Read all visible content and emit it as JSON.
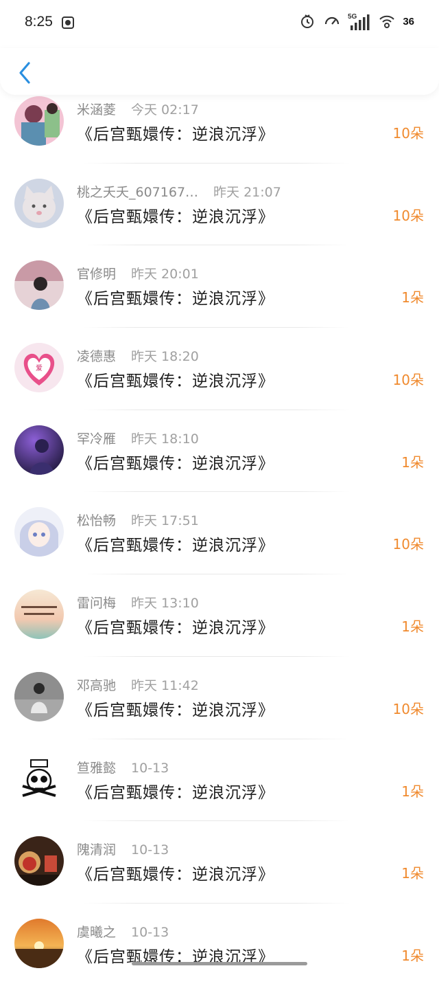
{
  "status_bar": {
    "time": "8:25",
    "network": "5G",
    "battery": "36"
  },
  "header": {
    "back_icon": "chevron-left-icon"
  },
  "colors": {
    "accent_orange": "#f08a2e",
    "back_blue": "#2a8fe0"
  },
  "rows": [
    {
      "name": "米涵菱",
      "date": "今天 02:17",
      "work": "《后宫甄嬛传：逆浪沉浮》",
      "count": "10朵"
    },
    {
      "name": "桃之夭夭_607167…",
      "date": "昨天 21:07",
      "work": "《后宫甄嬛传：逆浪沉浮》",
      "count": "10朵"
    },
    {
      "name": "官修明",
      "date": "昨天 20:01",
      "work": "《后宫甄嬛传：逆浪沉浮》",
      "count": "1朵"
    },
    {
      "name": "凌德惠",
      "date": "昨天 18:20",
      "work": "《后宫甄嬛传：逆浪沉浮》",
      "count": "10朵"
    },
    {
      "name": "罕冷雁",
      "date": "昨天 18:10",
      "work": "《后宫甄嬛传：逆浪沉浮》",
      "count": "1朵"
    },
    {
      "name": "松怡畅",
      "date": "昨天 17:51",
      "work": "《后宫甄嬛传：逆浪沉浮》",
      "count": "10朵"
    },
    {
      "name": "雷问梅",
      "date": "昨天 13:10",
      "work": "《后宫甄嬛传：逆浪沉浮》",
      "count": "1朵"
    },
    {
      "name": "邓高驰",
      "date": "昨天 11:42",
      "work": "《后宫甄嬛传：逆浪沉浮》",
      "count": "10朵"
    },
    {
      "name": "笪雅懿",
      "date": "10-13",
      "work": "《后宫甄嬛传：逆浪沉浮》",
      "count": "1朵"
    },
    {
      "name": "隗清润",
      "date": "10-13",
      "work": "《后宫甄嬛传：逆浪沉浮》",
      "count": "1朵"
    },
    {
      "name": "虞曦之",
      "date": "10-13",
      "work": "《后宫甄嬛传：逆浪沉浮》",
      "count": "1朵"
    }
  ]
}
